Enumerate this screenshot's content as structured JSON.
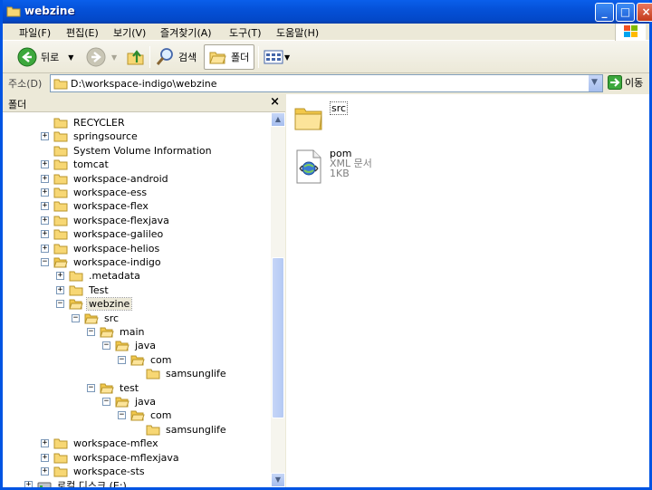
{
  "window": {
    "title": "webzine"
  },
  "menu": [
    "파일(F)",
    "편집(E)",
    "보기(V)",
    "즐겨찾기(A)",
    "도구(T)",
    "도움말(H)"
  ],
  "toolbar": {
    "back_label": "뒤로",
    "search_label": "검색",
    "folders_label": "폴더"
  },
  "address": {
    "label": "주소(D)",
    "value": "D:\\workspace-indigo\\webzine",
    "go_label": "이동"
  },
  "folders_pane": {
    "title": "폴더",
    "close_glyph": "×"
  },
  "tree": [
    {
      "label": "RECYCLER",
      "level": 0,
      "expander": ""
    },
    {
      "label": "springsource",
      "level": 0,
      "expander": "+"
    },
    {
      "label": "System Volume Information",
      "level": 0,
      "expander": ""
    },
    {
      "label": "tomcat",
      "level": 0,
      "expander": "+"
    },
    {
      "label": "workspace-android",
      "level": 0,
      "expander": "+"
    },
    {
      "label": "workspace-ess",
      "level": 0,
      "expander": "+"
    },
    {
      "label": "workspace-flex",
      "level": 0,
      "expander": "+"
    },
    {
      "label": "workspace-flexjava",
      "level": 0,
      "expander": "+"
    },
    {
      "label": "workspace-galileo",
      "level": 0,
      "expander": "+"
    },
    {
      "label": "workspace-helios",
      "level": 0,
      "expander": "+"
    },
    {
      "label": "workspace-indigo",
      "level": 0,
      "expander": "−"
    },
    {
      "label": ".metadata",
      "level": 1,
      "expander": "+"
    },
    {
      "label": "Test",
      "level": 1,
      "expander": "+"
    },
    {
      "label": "webzine",
      "level": 1,
      "expander": "−",
      "selected": true
    },
    {
      "label": "src",
      "level": 2,
      "expander": "−"
    },
    {
      "label": "main",
      "level": 3,
      "expander": "−"
    },
    {
      "label": "java",
      "level": 4,
      "expander": "−"
    },
    {
      "label": "com",
      "level": 5,
      "expander": "−"
    },
    {
      "label": "samsunglife",
      "level": 6,
      "expander": ""
    },
    {
      "label": "test",
      "level": 3,
      "expander": "−"
    },
    {
      "label": "java",
      "level": 4,
      "expander": "−"
    },
    {
      "label": "com",
      "level": 5,
      "expander": "−"
    },
    {
      "label": "samsunglife",
      "level": 6,
      "expander": ""
    },
    {
      "label": "workspace-mflex",
      "level": 0,
      "expander": "+"
    },
    {
      "label": "workspace-mflexjava",
      "level": 0,
      "expander": "+"
    },
    {
      "label": "workspace-sts",
      "level": 0,
      "expander": "+"
    },
    {
      "label": "로컬 디스크 (E:)",
      "level": -1,
      "expander": "+",
      "drive": true
    }
  ],
  "files": [
    {
      "name": "src",
      "type": "folder"
    },
    {
      "name": "pom",
      "type": "XML 문서",
      "size": "1KB"
    }
  ]
}
